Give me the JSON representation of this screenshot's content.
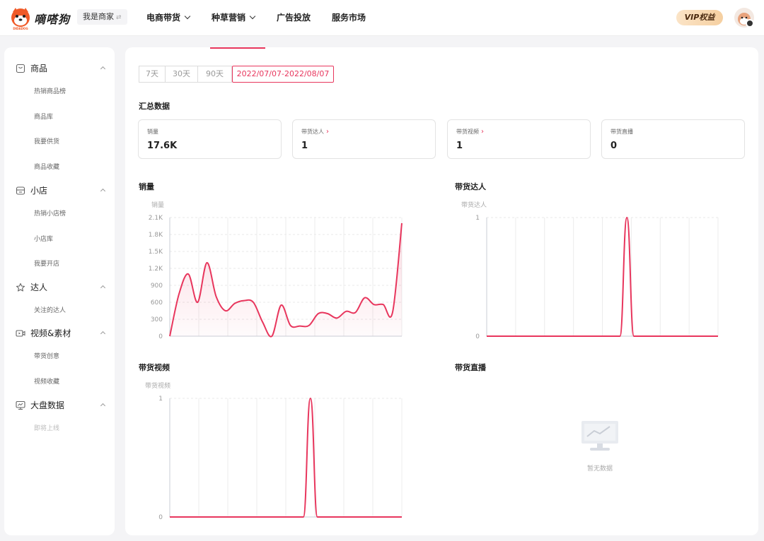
{
  "header": {
    "brand": "嘀嗒狗",
    "merchant": "我是商家",
    "merchant_switch": "⇄",
    "nav": [
      {
        "label": "电商带货",
        "has_menu": true
      },
      {
        "label": "种草营销",
        "has_menu": true
      },
      {
        "label": "广告投放",
        "has_menu": false
      },
      {
        "label": "服务市场",
        "has_menu": false
      }
    ],
    "vip": "VIP权益"
  },
  "sidebar": {
    "sections": [
      {
        "icon": "bag-icon",
        "label": "商品",
        "items": [
          "热销商品榜",
          "商品库",
          "我要供货",
          "商品收藏"
        ]
      },
      {
        "icon": "store-icon",
        "label": "小店",
        "items": [
          "热销小店榜",
          "小店库",
          "我要开店"
        ]
      },
      {
        "icon": "star-user-icon",
        "label": "达人",
        "items": [
          "关注的达人"
        ]
      },
      {
        "icon": "video-icon",
        "label": "视频&素材",
        "items": [
          "带货创意",
          "视频收藏"
        ]
      },
      {
        "icon": "monitor-icon",
        "label": "大盘数据",
        "items": [
          "即将上线"
        ]
      }
    ]
  },
  "main": {
    "date_tabs": [
      "7天",
      "30天",
      "90天",
      "2022/07/07-2022/08/07"
    ],
    "active_tab": 3,
    "summary_title": "汇总数据",
    "cards": [
      {
        "label": "销量",
        "value": "17.6K",
        "link": false
      },
      {
        "label": "带货达人",
        "value": "1",
        "link": true
      },
      {
        "label": "带货视频",
        "value": "1",
        "link": true
      },
      {
        "label": "带货直播",
        "value": "0",
        "link": false
      }
    ],
    "empty_text": "暂无数据"
  },
  "colors": {
    "accent": "#e8365d"
  },
  "chart_data": [
    {
      "type": "area",
      "title": "销量",
      "ylabel": "销量",
      "yticks": [
        "0",
        "300",
        "600",
        "900",
        "1.2K",
        "1.5K",
        "1.8K",
        "2.1K"
      ],
      "ylim": [
        0,
        2100
      ],
      "x": [
        0,
        1,
        2,
        3,
        4,
        5,
        6,
        7,
        8,
        9,
        10,
        11,
        12,
        13,
        14,
        15,
        16,
        17,
        18,
        19,
        20,
        21,
        22,
        23,
        24,
        25,
        26,
        27,
        28,
        29,
        30,
        31
      ],
      "values": [
        0,
        750,
        1100,
        600,
        1300,
        700,
        450,
        580,
        630,
        600,
        250,
        0,
        550,
        190,
        180,
        190,
        400,
        400,
        320,
        440,
        420,
        680,
        560,
        560,
        420,
        2000
      ]
    },
    {
      "type": "line",
      "title": "带货达人",
      "ylabel": "带货达人",
      "yticks": [
        "0",
        "1"
      ],
      "ylim": [
        0,
        1
      ],
      "values": [
        0,
        0,
        0,
        0,
        0,
        0,
        0,
        0,
        0,
        0,
        0,
        0,
        0,
        0,
        0,
        0,
        0,
        0,
        0,
        0,
        1,
        0,
        0,
        0,
        0,
        0,
        0,
        0,
        0,
        0,
        0,
        0,
        0,
        0
      ]
    },
    {
      "type": "line",
      "title": "带货视频",
      "ylabel": "带货视频",
      "yticks": [
        "0",
        "1"
      ],
      "ylim": [
        0,
        1
      ],
      "values": [
        0,
        0,
        0,
        0,
        0,
        0,
        0,
        0,
        0,
        0,
        0,
        0,
        0,
        0,
        0,
        0,
        0,
        0,
        0,
        0,
        1,
        0,
        0,
        0,
        0,
        0,
        0,
        0,
        0,
        0,
        0,
        0,
        0,
        0
      ]
    },
    {
      "type": "line",
      "title": "带货直播",
      "values": []
    }
  ]
}
